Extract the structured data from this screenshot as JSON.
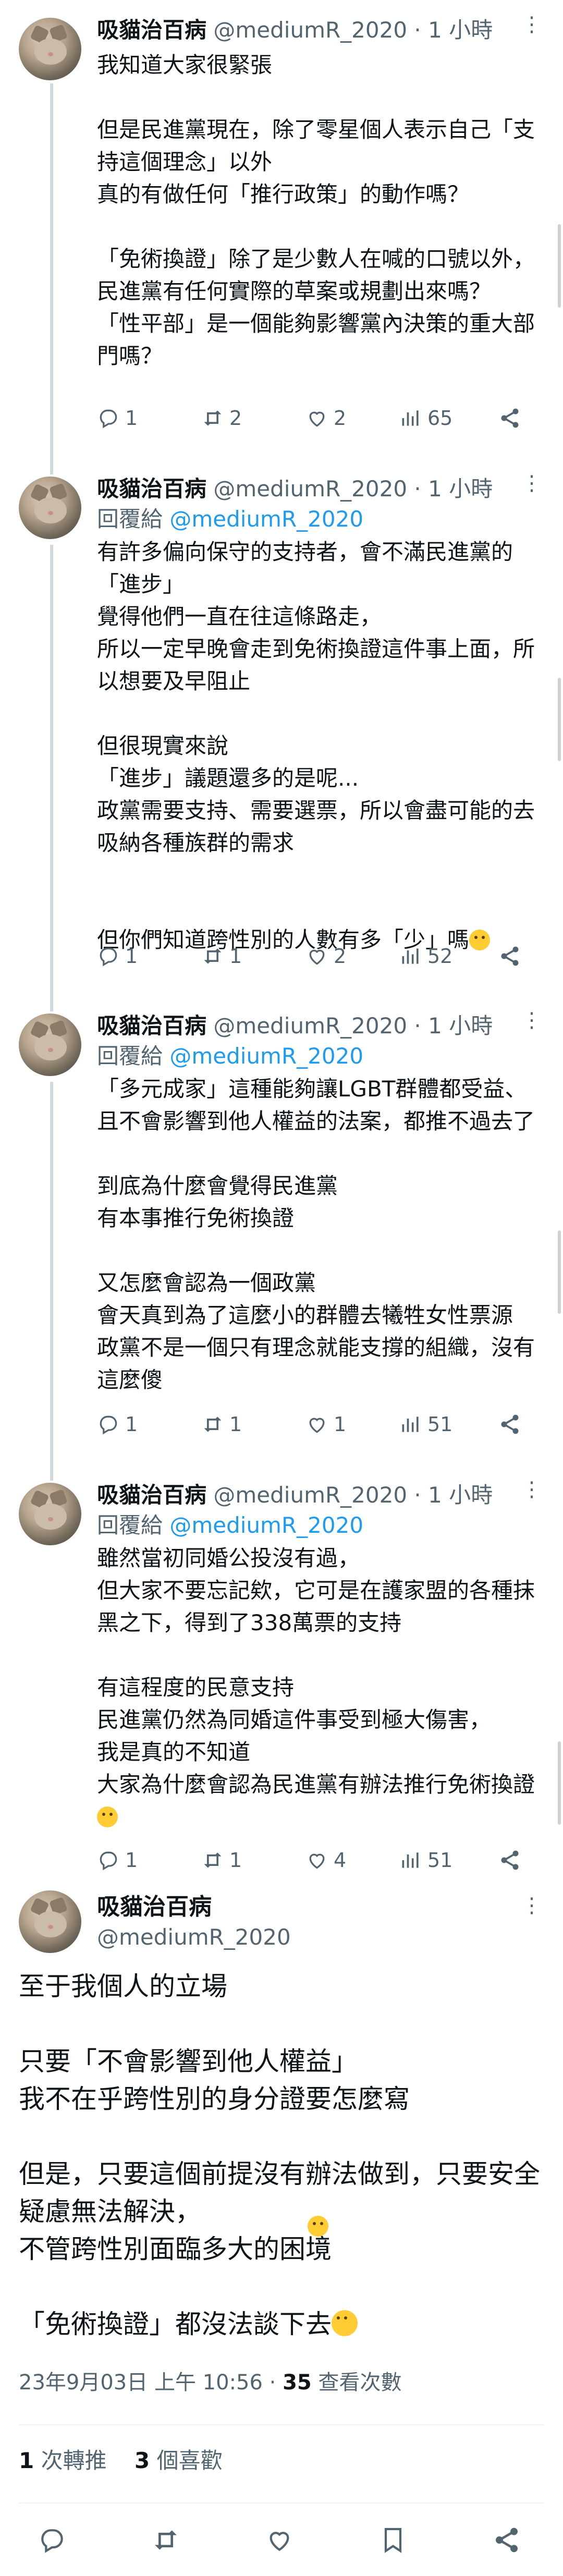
{
  "author": {
    "name": "吸貓治百病",
    "handle": "@mediumR_2020",
    "time": "1 小時",
    "dot": "·"
  },
  "reply_to": {
    "prefix": "回覆給 ",
    "handle": "@mediumR_2020"
  },
  "tweets": [
    {
      "body": "我知道大家很緊張\n\n但是民進黨現在，除了零星個人表示自己「支持這個理念」以外\n真的有做任何「推行政策」的動作嗎？\n\n「免術換證」除了是少數人在喊的口號以外，民進黨有任何實際的草案或規劃出來嗎？\n「性平部」是一個能夠影響黨內決策的重大部門嗎？",
      "replies": "1",
      "retweets": "2",
      "likes": "2",
      "views": "65"
    },
    {
      "body": "有許多偏向保守的支持者，會不滿民進黨的「進步」\n覺得他們一直在往這條路走，\n所以一定早晚會走到免術換證這件事上面，所以想要及早阻止\n\n但很現實來說\n「進步」議題還多的是呢...\n政黨需要支持、需要選票，所以會盡可能的去吸納各種族群的需求\n\n\n但你們知道跨性別的人數有多「少」嗎",
      "replies": "1",
      "retweets": "1",
      "likes": "2",
      "views": "52"
    },
    {
      "body": "「多元成家」這種能夠讓LGBT群體都受益、且不會影響到他人權益的法案，都推不過去了\n\n到底為什麼會覺得民進黨\n有本事推行免術換證\n\n又怎麼會認為一個政黨\n會天真到為了這麼小的群體去犧牲女性票源\n政黨不是一個只有理念就能支撐的組織，沒有這麼傻",
      "replies": "1",
      "retweets": "1",
      "likes": "1",
      "views": "51"
    },
    {
      "body": "雖然當初同婚公投沒有過，\n但大家不要忘記欸，它可是在護家盟的各種抹黑之下，得到了338萬票的支持\n\n有這程度的民意支持\n民進黨仍然為同婚這件事受到極大傷害，\n我是真的不知道\n大家為什麼會認為民進黨有辦法推行免術換證",
      "replies": "1",
      "retweets": "1",
      "likes": "4",
      "views": "51"
    }
  ],
  "main_tweet": {
    "name": "吸貓治百病",
    "handle": "@mediumR_2020",
    "body": "至于我個人的立場\n\n只要「不會影響到他人權益」\n我不在乎跨性別的身分證要怎麼寫\n\n但是，只要這個前提沒有辦法做到，只要安全疑慮無法解決，\n不管跨性別面臨多大的困境\n\n「免術換證」都沒法談下去",
    "timestamp": "23年9月03日 上午 10:56 · ",
    "views_count": "35",
    "views_label": " 查看次數",
    "retweet_count": "1",
    "retweet_label": " 次轉推",
    "like_count": "3",
    "like_label": " 個喜歡"
  },
  "icons": [
    "reply-icon",
    "retweet-icon",
    "like-icon",
    "views-icon",
    "share-icon",
    "bookmark-icon",
    "more-icon"
  ],
  "colors": {
    "link": "#1d9bf0",
    "muted": "#536471",
    "text": "#0f1419"
  }
}
